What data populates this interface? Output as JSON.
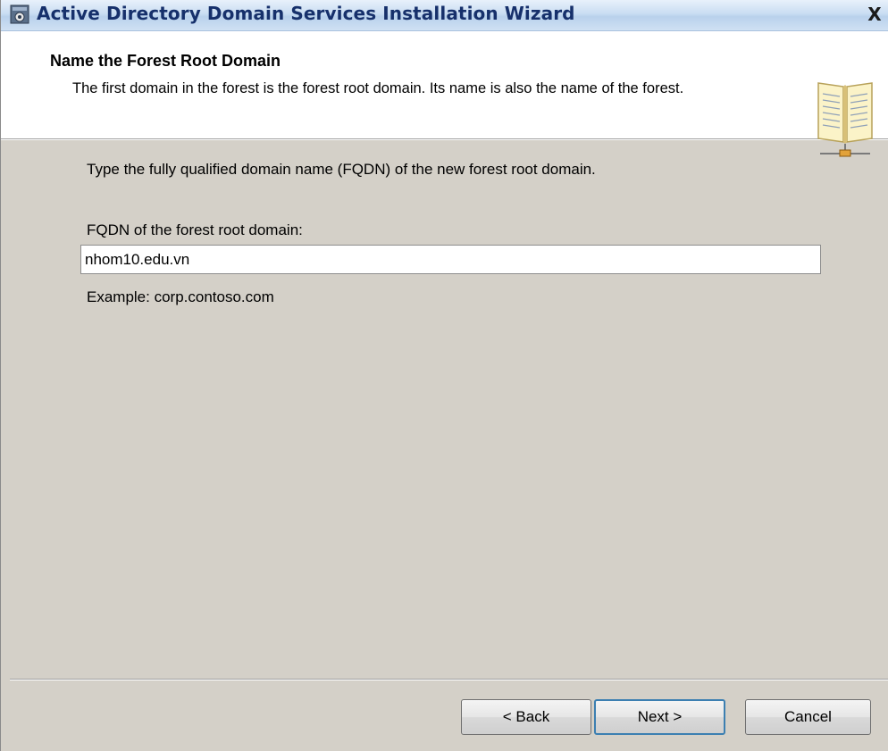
{
  "window": {
    "title": "Active Directory Domain Services Installation Wizard",
    "close_label": "X"
  },
  "header": {
    "title": "Name the Forest Root Domain",
    "subtitle": "The first domain in the forest is the forest root domain. Its name is also the name of the forest."
  },
  "main": {
    "instruction": "Type the fully qualified domain name (FQDN) of the new forest root domain.",
    "fqdn_label": "FQDN of the forest root domain:",
    "fqdn_value": "nhom10.edu.vn",
    "example": "Example: corp.contoso.com"
  },
  "buttons": {
    "back": "< Back",
    "next": "Next >",
    "cancel": "Cancel"
  },
  "icons": {
    "title_icon": "ad-wizard-icon",
    "header_icon": "book-network-icon",
    "close_icon": "close-icon"
  },
  "colors": {
    "title_text": "#16306b",
    "dialog_bg": "#d4d0c8",
    "header_bg": "#ffffff",
    "default_button_border": "#3c7fb1"
  }
}
